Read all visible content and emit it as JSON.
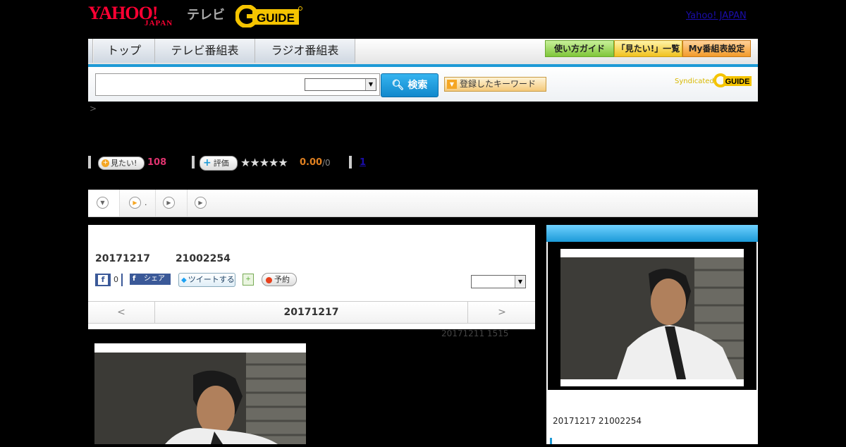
{
  "header": {
    "logo_yahoo": "YAHOO!",
    "logo_japan": "JAPAN",
    "logo_tv": "テレビ",
    "logo_gguide": "GUIDE",
    "yahoo_japan_link": "Yahoo! JAPAN"
  },
  "nav": {
    "tabs": [
      "トップ",
      "テレビ番組表",
      "ラジオ番組表"
    ],
    "buttons": [
      "使い方ガイド",
      "「見たい!」一覧",
      "My番組表設定"
    ]
  },
  "search": {
    "input_value": "",
    "select_value": "",
    "button_label": "検索",
    "keyword_button": "登録したキーワード",
    "syndicated": "Syndicated"
  },
  "breadcrumb": ">",
  "stats": {
    "want_label": "見たい!",
    "want_count": "108",
    "rate_label": "評価",
    "rating_value": "0.00",
    "rating_count": "/0",
    "review_link": "1",
    "stars": 0
  },
  "tabs": {
    "tab2_suffix": "."
  },
  "program": {
    "date_code": "20171217",
    "id_code": "21002254",
    "fb_like_count": "0",
    "fb_share": "シェア",
    "tweet": "ツイートする",
    "reserve": "予約",
    "select_value": ""
  },
  "date_nav": {
    "prev": "<",
    "date": "20171217",
    "next": ">"
  },
  "updated": "20171211  1515",
  "sidebar": {
    "date_line": "20171217  21002254"
  },
  "colors": {
    "accent_blue": "#1e9ad6",
    "yahoo_red": "#ff0033",
    "gguide_yellow": "#f5c400",
    "want_pink": "#e0336f",
    "rating_orange": "#e08020"
  }
}
